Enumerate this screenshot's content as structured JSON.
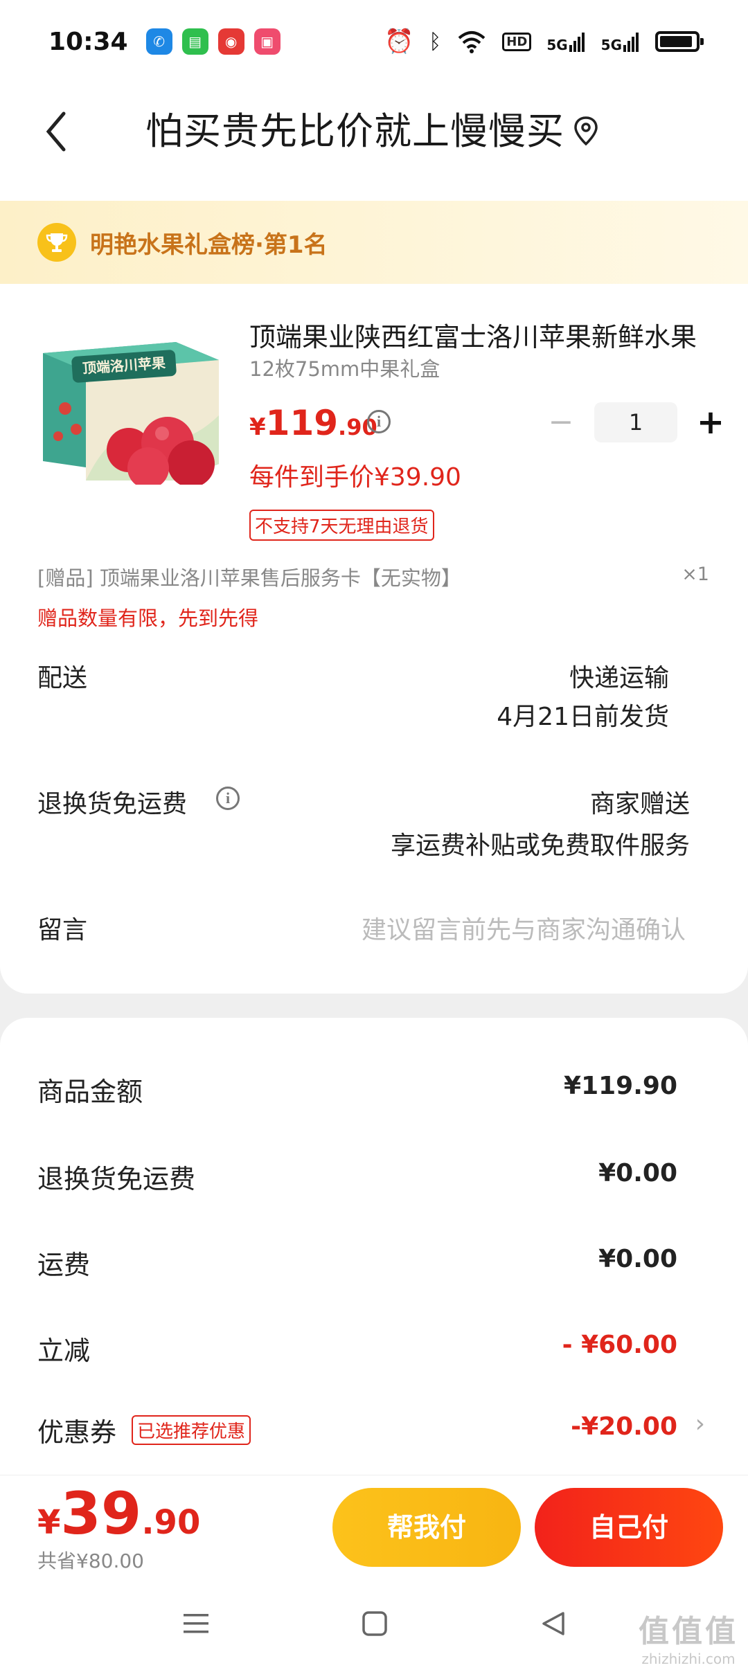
{
  "status_bar": {
    "time": "10:34",
    "hd": "HD",
    "net1": "5G",
    "net2": "5G"
  },
  "header": {
    "title": "怕买贵先比价就上慢慢买"
  },
  "rank_banner": {
    "text": "明艳水果礼盒榜·第1名"
  },
  "product": {
    "name": "顶端果业陕西红富士洛川苹果新鲜水果",
    "spec": "12枚75mm中果礼盒",
    "image_text": "顶端洛川苹果",
    "price_currency": "¥",
    "price_int": "119",
    "price_dec": ".90",
    "unit_price": "每件到手价¥39.90",
    "quantity": "1",
    "minus_label": "−",
    "plus_label": "+",
    "return_tag": "不支持7天无理由退货",
    "gift_text": "[赠品]  顶端果业洛川苹果售后服务卡【无实物】",
    "gift_qty": "×1",
    "gift_tip": "赠品数量有限，先到先得"
  },
  "delivery": {
    "label": "配送",
    "method": "快递运输",
    "ship_date": "4月21日前发货"
  },
  "return_shipping": {
    "label": "退换货免运费",
    "value1": "商家赠送",
    "value2": "享运费补贴或免费取件服务"
  },
  "message": {
    "label": "留言",
    "placeholder": "建议留言前先与商家沟通确认"
  },
  "summary": {
    "goods_amount_label": "商品金额",
    "goods_amount": "¥119.90",
    "return_fee_label": "退换货免运费",
    "return_fee": "¥0.00",
    "shipping_label": "运费",
    "shipping": "¥0.00",
    "discount_label": "立减",
    "discount": "- ¥60.00",
    "coupon_label": "优惠券",
    "coupon_tag": "已选推荐优惠",
    "coupon": "-¥20.00",
    "chevron": "›"
  },
  "bottom": {
    "total_currency": "¥",
    "total_int": "39",
    "total_dec": ".90",
    "saved": "共省¥80.00",
    "help_pay": "帮我付",
    "self_pay": "自己付"
  },
  "watermark": {
    "line1": "值值值",
    "line2": "zhizhizhi.com"
  },
  "colors": {
    "accent_red": "#e0251b",
    "accent_yellow": "#fcc21b",
    "rank_text": "#c8731a"
  }
}
